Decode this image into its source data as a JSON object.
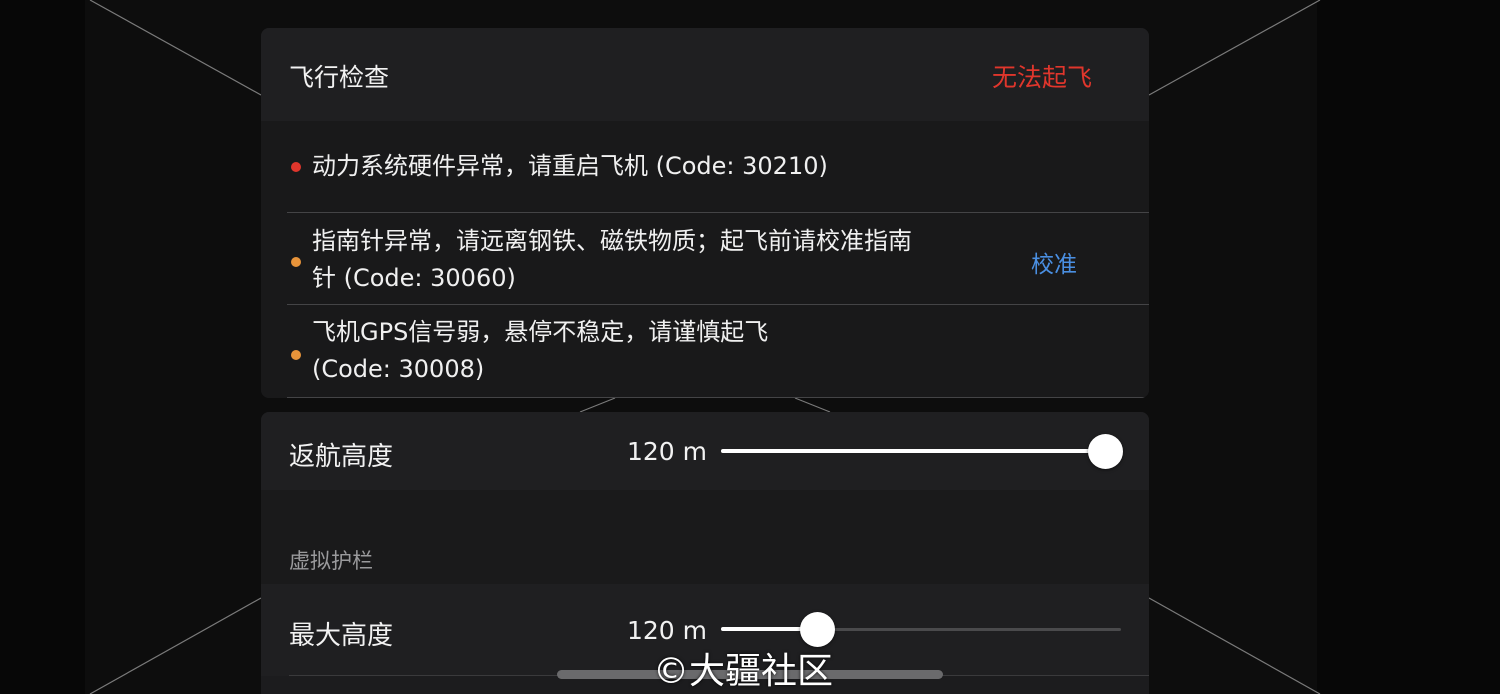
{
  "flight_check": {
    "title": "飞行检查",
    "status": "无法起飞",
    "status_color": "#e0362c",
    "items": [
      {
        "severity": "error",
        "dot_color": "#e0362c",
        "lines": [
          "动力系统硬件异常，请重启飞机 (Code: 30210)"
        ]
      },
      {
        "severity": "warning",
        "dot_color": "#e8943a",
        "lines": [
          "指南针异常，请远离钢铁、磁铁物质；起飞前请校准指南",
          "针 (Code: 30060)"
        ],
        "action": "校准"
      },
      {
        "severity": "warning",
        "dot_color": "#e8943a",
        "lines": [
          "飞机GPS信号弱，悬停不稳定，请谨慎起飞",
          "(Code: 30008)"
        ]
      }
    ]
  },
  "settings": {
    "rth_altitude": {
      "label": "返航高度",
      "value": "120 m",
      "slider_fraction": 0.96
    },
    "geofence_section": "虚拟护栏",
    "max_altitude": {
      "label": "最大高度",
      "value": "120 m",
      "slider_fraction": 0.24
    }
  },
  "watermark": "©大疆社区",
  "colors": {
    "accent_link": "#4a8fe2",
    "card_bg": "#1c1c1e"
  }
}
